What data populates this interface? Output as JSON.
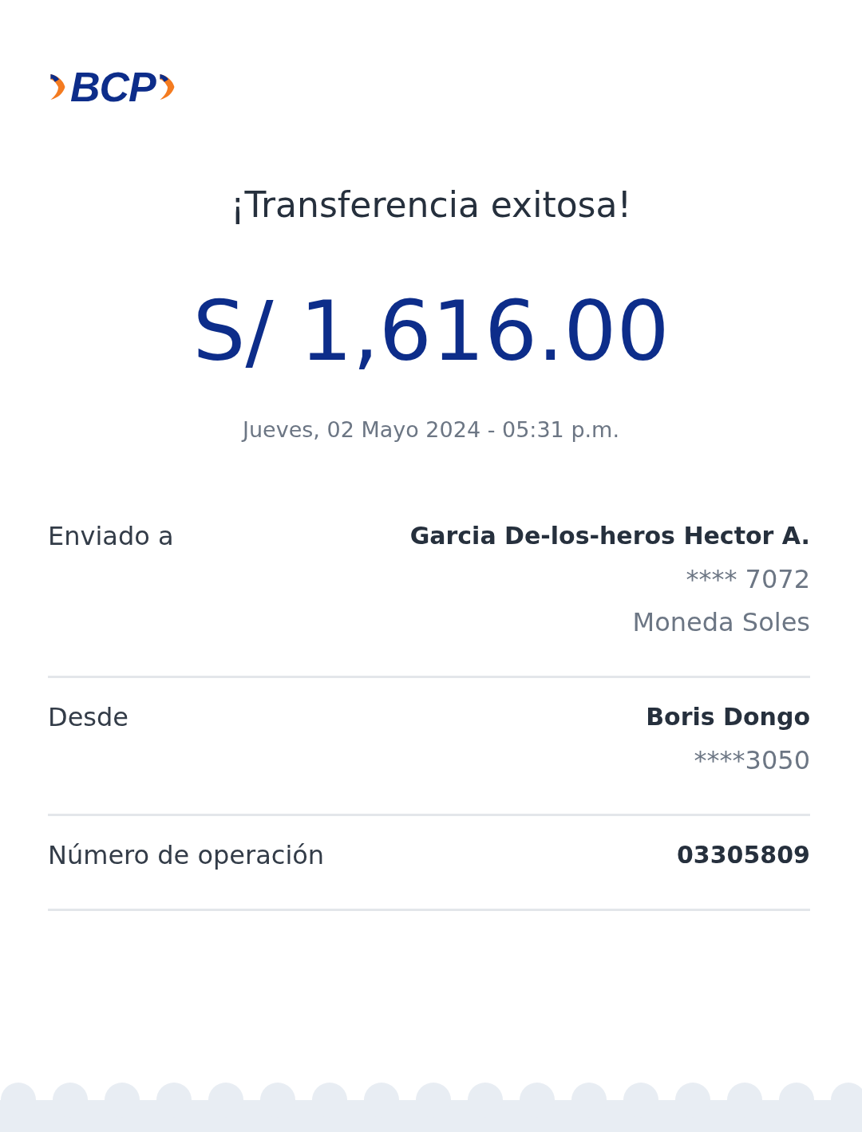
{
  "logo": {
    "text": "BCP"
  },
  "title": "¡Transferencia exitosa!",
  "amount": "S/ 1,616.00",
  "datetime": "Jueves, 02 Mayo 2024 - 05:31 p.m.",
  "details": [
    {
      "label": "Enviado a",
      "values": [
        {
          "kind": "strong",
          "text": "Garcia De-los-heros Hector A."
        },
        {
          "kind": "plain",
          "text": "**** 7072"
        },
        {
          "kind": "plain",
          "text": "Moneda Soles"
        }
      ]
    },
    {
      "label": "Desde",
      "values": [
        {
          "kind": "strong",
          "text": "Boris Dongo"
        },
        {
          "kind": "plain",
          "text": "****3050"
        }
      ]
    },
    {
      "label": "Número de operación",
      "values": [
        {
          "kind": "strong",
          "text": "03305809"
        }
      ]
    }
  ]
}
